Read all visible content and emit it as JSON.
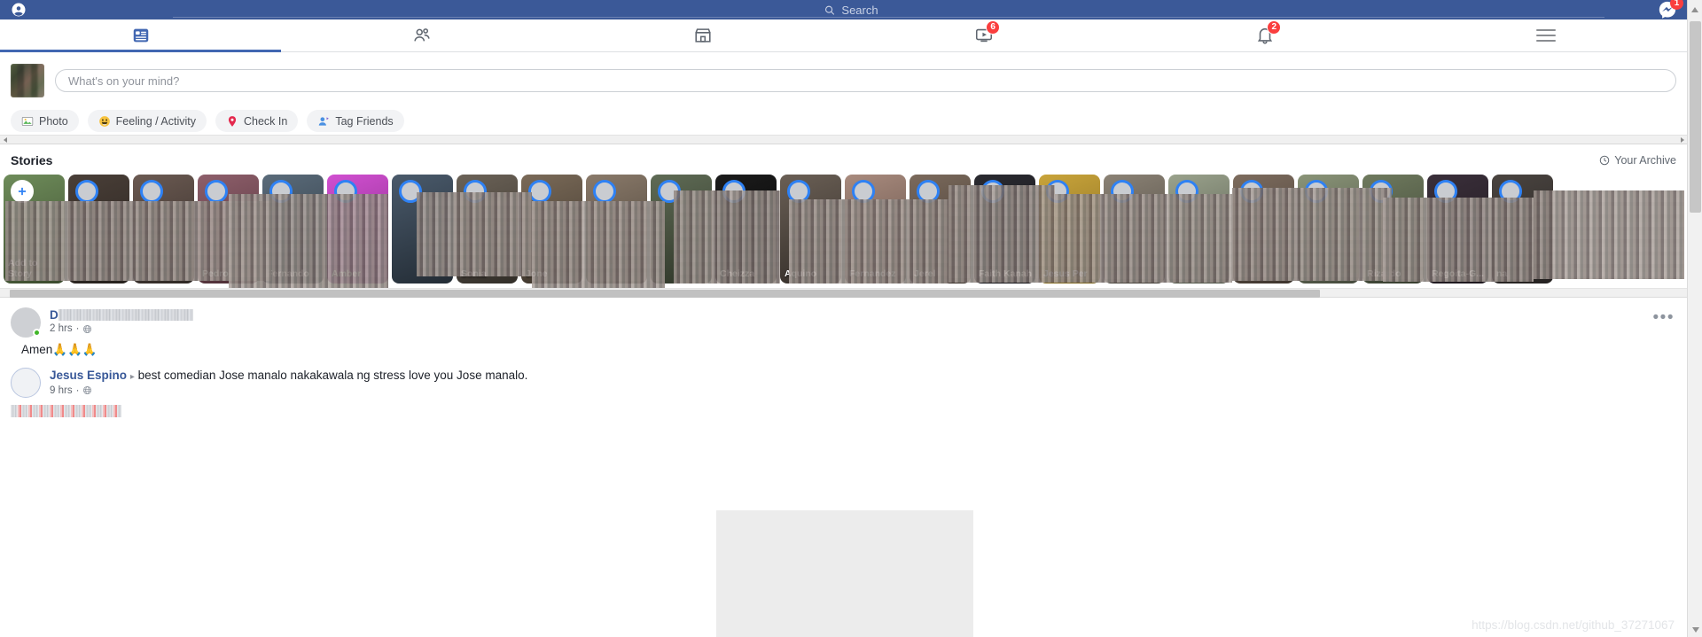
{
  "topbar": {
    "profile_icon": "account-circle-icon",
    "search_icon": "search-icon",
    "search_placeholder": "Search",
    "messenger_icon": "messenger-icon",
    "messenger_badge": "1"
  },
  "navtabs": [
    {
      "name": "news-feed",
      "icon": "news-feed-icon",
      "active": true,
      "badge": ""
    },
    {
      "name": "friends",
      "icon": "friends-icon",
      "active": false,
      "badge": ""
    },
    {
      "name": "marketplace",
      "icon": "marketplace-icon",
      "active": false,
      "badge": ""
    },
    {
      "name": "watch",
      "icon": "watch-icon",
      "active": false,
      "badge": "6"
    },
    {
      "name": "notifications",
      "icon": "bell-icon",
      "active": false,
      "badge": "2"
    },
    {
      "name": "menu",
      "icon": "hamburger-icon",
      "active": false,
      "badge": ""
    }
  ],
  "composer": {
    "placeholder": "What's on your mind?",
    "actions": [
      {
        "label": "Photo",
        "icon": "photo-icon",
        "glyph": "🖼"
      },
      {
        "label": "Feeling / Activity",
        "icon": "smiley-icon",
        "glyph": "😀"
      },
      {
        "label": "Check In",
        "icon": "location-pin-icon",
        "glyph": "📍"
      },
      {
        "label": "Tag Friends",
        "icon": "tag-friends-icon",
        "glyph": "👤"
      }
    ]
  },
  "stories": {
    "title": "Stories",
    "archive_label": "Your Archive",
    "archive_icon": "clock-icon",
    "add_story_label": "Add to Story",
    "items": [
      {
        "name": ""
      },
      {
        "name": ""
      },
      {
        "name": ""
      },
      {
        "name": "Pedro"
      },
      {
        "name": "Fernando"
      },
      {
        "name": "Amber"
      },
      {
        "name": ""
      },
      {
        "name": "Sonia"
      },
      {
        "name": "Jone"
      },
      {
        "name": ""
      },
      {
        "name": ""
      },
      {
        "name": "Cheizza"
      },
      {
        "name": "Aquino"
      },
      {
        "name": "Fernandez"
      },
      {
        "name": "Jerel"
      },
      {
        "name": "Faith Kanah"
      },
      {
        "name": "Jesus Per"
      },
      {
        "name": ""
      },
      {
        "name": ""
      },
      {
        "name": ""
      },
      {
        "name": ""
      },
      {
        "name": "Rizardo"
      },
      {
        "name": "Regoita-G..."
      },
      {
        "name": "na"
      }
    ]
  },
  "feed": {
    "post": {
      "author_visible_prefix": "D",
      "author_blurred": true,
      "time": "2 hrs",
      "privacy_icon": "globe-icon",
      "text": "Amen🙏🙏🙏",
      "menu_icon": "more-options-icon",
      "menu_glyph": "•••"
    },
    "shared_post": {
      "author": "Jesus Espino",
      "caret": "▸",
      "text": "best comedian Jose manalo nakakawala ng stress love you Jose manalo.",
      "time": "9 hrs",
      "privacy_icon": "globe-icon"
    }
  },
  "watermark": "https://blog.csdn.net/github_37271067",
  "colors": {
    "fb_blue": "#3b5998",
    "accent_blue": "#4267b2",
    "badge_red": "#fa3e3e",
    "online_green": "#42b72a",
    "story_ring": "#2e81f4"
  }
}
